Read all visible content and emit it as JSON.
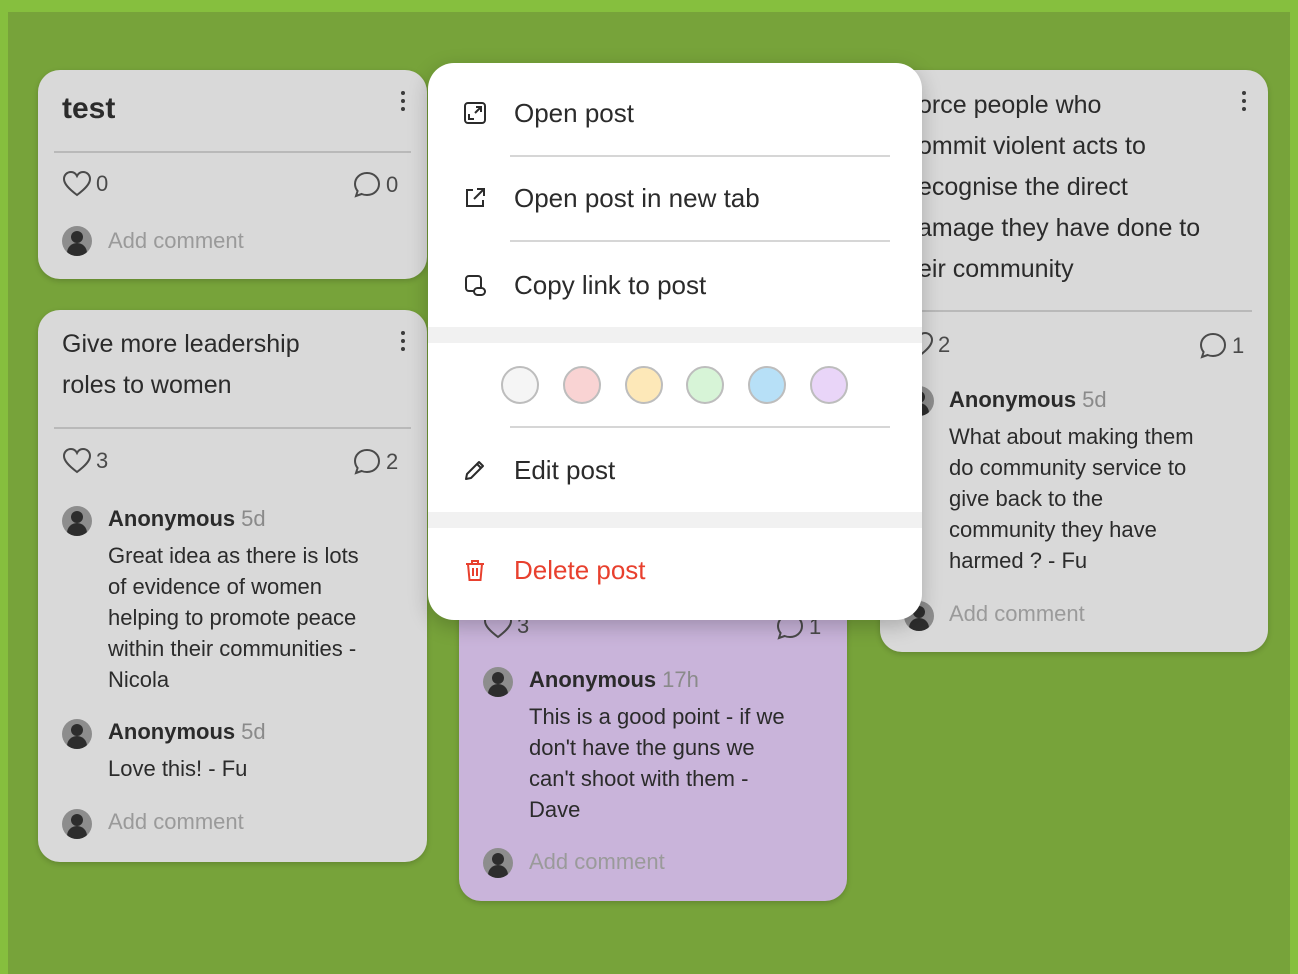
{
  "posts": [
    {
      "title": "test",
      "likes": "0",
      "comments_count": "0",
      "add_comment": "Add comment"
    },
    {
      "title_lines": [
        "Give more leadership",
        "roles to women"
      ],
      "likes": "3",
      "comments_count": "2",
      "comments": [
        {
          "author": "Anonymous",
          "time": "5d",
          "lines": [
            "Great idea as there is lots",
            "of evidence of women",
            "helping to promote peace",
            "within their communities -",
            "Nicola"
          ]
        },
        {
          "author": "Anonymous",
          "time": "5d",
          "lines": [
            "Love this! - Fu"
          ]
        }
      ],
      "add_comment": "Add comment"
    },
    {
      "likes": "3",
      "comments_count": "1",
      "comments": [
        {
          "author": "Anonymous",
          "time": "17h",
          "lines": [
            "This is a good point - if we",
            "don't have the guns we",
            "can't shoot with them -",
            "Dave"
          ]
        }
      ],
      "add_comment": "Add comment"
    },
    {
      "title_lines": [
        "orce people who",
        "ommit violent acts to",
        "ecognise the direct",
        "amage they have done to",
        "eir community"
      ],
      "likes": "2",
      "comments_count": "1",
      "comments": [
        {
          "author": "Anonymous",
          "time": "5d",
          "lines": [
            "What about making them",
            "do community service to",
            "give back to the",
            "community they have",
            "harmed ? - Fu"
          ]
        }
      ],
      "add_comment": "Add comment"
    }
  ],
  "menu": {
    "open_post": "Open post",
    "open_new_tab": "Open post in new tab",
    "copy_link": "Copy link to post",
    "edit_post": "Edit post",
    "delete_post": "Delete post",
    "colors": [
      "#f5f5f5",
      "#f9d3d3",
      "#fde8b8",
      "#d7f4d7",
      "#b7e0f7",
      "#e9d5f8"
    ]
  },
  "theme": {
    "background": "#77a33a",
    "card": "#d9d9d9",
    "card_purple": "#c9b4da",
    "danger": "#e8402e"
  },
  "icons": [
    "kebab-icon",
    "heart-icon",
    "comment-icon",
    "avatar-icon",
    "open-post-icon",
    "external-link-icon",
    "copy-link-icon",
    "pencil-icon",
    "trash-icon"
  ]
}
